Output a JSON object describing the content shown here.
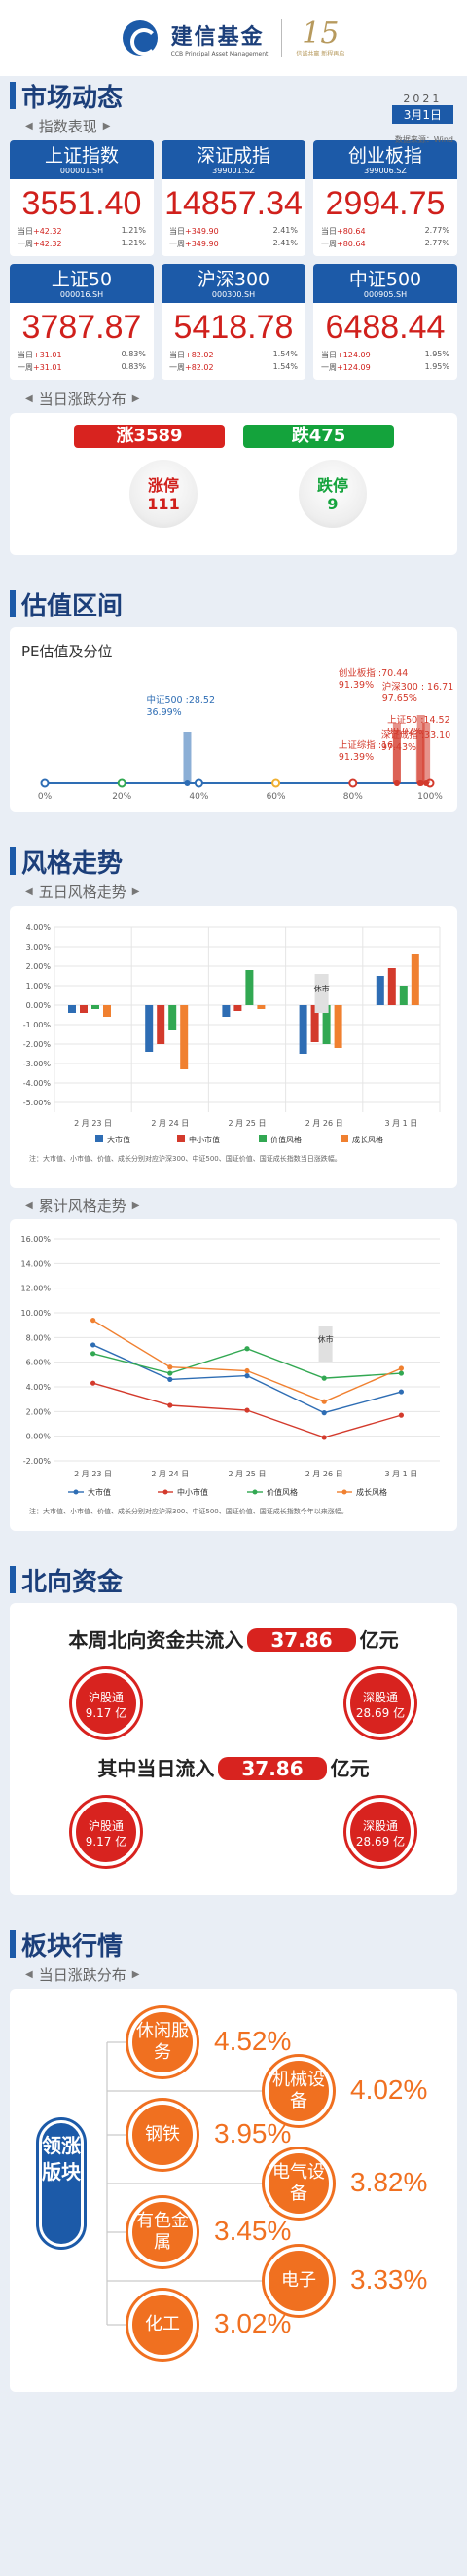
{
  "header": {
    "brand_cn": "建信基金",
    "brand_en": "CCB Principal Asset Management",
    "anniv_num": "15",
    "anniv_sub": "信诚共赢 新程再启"
  },
  "market": {
    "title": "市场动态",
    "year": "2021",
    "date": "3月1日",
    "source": "数据来源：Wind",
    "perf_title": "指数表现",
    "indices": [
      {
        "name": "上证指数",
        "code": "000001.SH",
        "value": "3551.40",
        "day_label": "当日",
        "day_chg": "+42.32",
        "day_pct": "1.21%",
        "week_label": "一周",
        "week_chg": "+42.32",
        "week_pct": "1.21%"
      },
      {
        "name": "深证成指",
        "code": "399001.SZ",
        "value": "14857.34",
        "day_label": "当日",
        "day_chg": "+349.90",
        "day_pct": "2.41%",
        "week_label": "一周",
        "week_chg": "+349.90",
        "week_pct": "2.41%"
      },
      {
        "name": "创业板指",
        "code": "399006.SZ",
        "value": "2994.75",
        "day_label": "当日",
        "day_chg": "+80.64",
        "day_pct": "2.77%",
        "week_label": "一周",
        "week_chg": "+80.64",
        "week_pct": "2.77%"
      },
      {
        "name": "上证50",
        "code": "000016.SH",
        "value": "3787.87",
        "day_label": "当日",
        "day_chg": "+31.01",
        "day_pct": "0.83%",
        "week_label": "一周",
        "week_chg": "+31.01",
        "week_pct": "0.83%"
      },
      {
        "name": "沪深300",
        "code": "000300.SH",
        "value": "5418.78",
        "day_label": "当日",
        "day_chg": "+82.02",
        "day_pct": "1.54%",
        "week_label": "一周",
        "week_chg": "+82.02",
        "week_pct": "1.54%"
      },
      {
        "name": "中证500",
        "code": "000905.SH",
        "value": "6488.44",
        "day_label": "当日",
        "day_chg": "+124.09",
        "day_pct": "1.95%",
        "week_label": "一周",
        "week_chg": "+124.09",
        "week_pct": "1.95%"
      }
    ],
    "dist_title": "当日涨跌分布",
    "up_label": "涨3589",
    "down_label": "跌475",
    "limit_up_label": "涨停",
    "limit_up_count": "111",
    "limit_down_label": "跌停",
    "limit_down_count": "9"
  },
  "valuation": {
    "title": "估值区间",
    "chart_title": "PE估值及分位",
    "ticks": [
      "0%",
      "20%",
      "40%",
      "60%",
      "80%",
      "100%"
    ],
    "labels": [
      {
        "text1": "中证500 :28.52",
        "text2": "36.99%"
      },
      {
        "text1": "上证综指 :16.",
        "text2": "91.39%"
      },
      {
        "text1": "创业板指 :70.44",
        "text2": "91.39%"
      },
      {
        "text1": "沪深300 : 16.71",
        "text2": "97.65%"
      },
      {
        "text1": "上证50 :14.52",
        "text2": "99.02%"
      },
      {
        "text1": "深证成指 :33.10",
        "text2": "97.43%"
      }
    ]
  },
  "style": {
    "title": "风格走势",
    "five_day_title": "五日风格走势",
    "cum_title": "累计风格走势",
    "badge": "休市",
    "note": "注：大市值、小市值、价值、成长分别对应沪深300、中证500、国证价值、国证成长指数当日涨跌幅。",
    "note2": "注：大市值、小市值、价值、成长分别对应沪深300、中证500、国证价值、国证成长指数今年以来涨幅。"
  },
  "north": {
    "title": "北向资金",
    "line1_pre": "本周北向资金共流入",
    "line1_amt": "37.86",
    "line1_unit": "亿元",
    "line2_pre": "其中当日流入",
    "line2_amt": "37.86",
    "line2_unit": "亿元",
    "rings": [
      {
        "name": "沪股通",
        "val": "9.17 亿"
      },
      {
        "name": "深股通",
        "val": "28.69 亿"
      },
      {
        "name": "沪股通",
        "val": "9.17 亿"
      },
      {
        "name": "深股通",
        "val": "28.69 亿"
      }
    ]
  },
  "sector": {
    "title": "板块行情",
    "dist_title": "当日涨跌分布",
    "lead": "领涨版块",
    "items": [
      {
        "name": "休闲服务",
        "pct": "4.52%"
      },
      {
        "name": "机械设备",
        "pct": "4.02%"
      },
      {
        "name": "钢铁",
        "pct": "3.95%"
      },
      {
        "name": "电气设备",
        "pct": "3.82%"
      },
      {
        "name": "有色金属",
        "pct": "3.45%"
      },
      {
        "name": "电子",
        "pct": "3.33%"
      },
      {
        "name": "化工",
        "pct": "3.02%"
      }
    ]
  },
  "chart_data": [
    {
      "type": "scatter",
      "title": "PE估值及分位",
      "x_unit": "%",
      "points": [
        {
          "name": "中证500",
          "pe": 28.52,
          "pct": 36.99
        },
        {
          "name": "上证综指",
          "pe": 16,
          "pct": 91.39
        },
        {
          "name": "创业板指",
          "pe": 70.44,
          "pct": 91.39
        },
        {
          "name": "沪深300",
          "pe": 16.71,
          "pct": 97.65
        },
        {
          "name": "上证50",
          "pe": 14.52,
          "pct": 99.02
        },
        {
          "name": "深证成指",
          "pe": 33.1,
          "pct": 97.43
        }
      ]
    },
    {
      "type": "bar",
      "categories": [
        "2 月 23 日",
        "2 月 24 日",
        "2 月 25 日",
        "2 月 26 日",
        "3 月 1 日"
      ],
      "ylim": [
        -5,
        4
      ],
      "yticks": [
        "4.00%",
        "3.00%",
        "2.00%",
        "1.00%",
        "0.00%",
        "-1.00%",
        "-2.00%",
        "-3.00%",
        "-4.00%",
        "-5.00%"
      ],
      "series": [
        {
          "name": "大市值",
          "color": "#2e6db4",
          "values": [
            -0.4,
            -2.4,
            -0.6,
            -2.5,
            1.5
          ]
        },
        {
          "name": "中小市值",
          "color": "#d33a2c",
          "values": [
            -0.4,
            -2.0,
            -0.3,
            -1.9,
            1.9
          ]
        },
        {
          "name": "价值风格",
          "color": "#32a852",
          "values": [
            -0.2,
            -1.3,
            1.8,
            -2.0,
            1.0
          ]
        },
        {
          "name": "成长风格",
          "color": "#f08030",
          "values": [
            -0.6,
            -3.3,
            -0.2,
            -2.2,
            2.6
          ]
        }
      ]
    },
    {
      "type": "line",
      "categories": [
        "2 月 23 日",
        "2 月 24 日",
        "2 月 25 日",
        "2 月 26 日",
        "3 月 1 日"
      ],
      "ylim": [
        -2,
        16
      ],
      "yticks": [
        "16.00%",
        "14.00%",
        "12.00%",
        "10.00%",
        "8.00%",
        "6.00%",
        "4.00%",
        "2.00%",
        "0.00%",
        "-2.00%"
      ],
      "series": [
        {
          "name": "大市值",
          "color": "#2e6db4",
          "values": [
            7.4,
            4.6,
            4.9,
            1.9,
            3.6
          ]
        },
        {
          "name": "中小市值",
          "color": "#d33a2c",
          "values": [
            4.3,
            2.5,
            2.1,
            -0.1,
            1.7
          ]
        },
        {
          "name": "价值风格",
          "color": "#32a852",
          "values": [
            6.7,
            5.1,
            7.1,
            4.7,
            5.1
          ]
        },
        {
          "name": "成长风格",
          "color": "#f08030",
          "values": [
            9.4,
            5.6,
            5.3,
            2.8,
            5.5
          ]
        }
      ]
    }
  ]
}
